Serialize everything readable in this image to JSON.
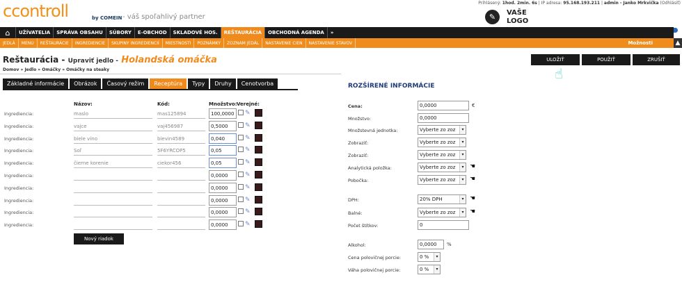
{
  "header": {
    "logo": "ccontroll",
    "by": "by COMEIN",
    "slogan": "- váš spoľahlivý partner",
    "login_label": "Prihlásený:",
    "login_time": "1hod. 2min. 6s",
    "ip_label": "IP adresa:",
    "ip": "95.168.193.211",
    "user": "admin - Janko Mrkvička",
    "logout": "(Odhlásiť)",
    "client_logo_line1": "VAŠE",
    "client_logo_line2": "LOGO"
  },
  "nav_main": [
    "UŽÍVATELIA",
    "SPRÁVA OBSAHU",
    "SÚBORY",
    "E-OBCHOD",
    "SKLADOVÉ HOS.",
    "REŠTAURÁCIA",
    "OBCHODNÁ AGENDA",
    "»"
  ],
  "nav_main_active": "REŠTAURÁCIA",
  "nav_sub": [
    "JEDLÁ",
    "MENU",
    "REŠTAURÁCIE",
    "INGREDIENCIE",
    "SKUPINY INGREDIENCIÍ",
    "MIESTNOSTI",
    "POZNÁMKY",
    "ZOZNAM JEDÁL",
    "NASTAVENIE CIEN",
    "NASTAVENIE STAVOV"
  ],
  "moznosti": "Možnosti",
  "page": {
    "title": "Reštaurácia -",
    "subtitle": "Upraviť jedlo -",
    "item_name": "Holandská omáčka",
    "breadcrumb": "Domov » Jedlo » Omáčky » Omáčky na steaky"
  },
  "actions": {
    "save": "ULOŽIŤ",
    "apply": "POUŽIŤ",
    "cancel": "ZRUŠIŤ"
  },
  "tabs": [
    "Základné informácie",
    "Obrázok",
    "Časový režim",
    "Receptúra",
    "Typy",
    "Druhy",
    "Cenotvorba"
  ],
  "active_tab": "Receptúra",
  "ingredients": {
    "col_name": "Názov:",
    "col_code": "Kód:",
    "col_qty": "Množstvo:",
    "col_public": "Verejné:",
    "row_label": "Ingrediencia:",
    "rows": [
      {
        "name": "maslo",
        "code": "mas125894",
        "qty": "100,0000"
      },
      {
        "name": "vajce",
        "code": "vaj456987",
        "qty": "0,5000"
      },
      {
        "name": "biele víno",
        "code": "bievin4589",
        "qty": "0,040"
      },
      {
        "name": "Soľ",
        "code": "5F6YRCOP5",
        "qty": "0,05"
      },
      {
        "name": "čierne korenie",
        "code": "ciekor456",
        "qty": "0,05"
      },
      {
        "name": "",
        "code": "",
        "qty": "0,0000"
      },
      {
        "name": "",
        "code": "",
        "qty": "0,0000"
      },
      {
        "name": "",
        "code": "",
        "qty": "0,0000"
      },
      {
        "name": "",
        "code": "",
        "qty": "0,0000"
      },
      {
        "name": "",
        "code": "",
        "qty": "0,0000"
      }
    ],
    "new_row_button": "Nový riadok"
  },
  "extended": {
    "heading": "ROZŠÍRENÉ INFORMÁCIE",
    "cena_label": "Cena:",
    "cena": "0,0000",
    "cena_unit": "€",
    "mnozstvo_label": "Množstvo:",
    "mnozstvo": "0,0000",
    "jednotka_label": "Množstevná jednotka:",
    "jednotka": "Vyberte zo zoz",
    "zobrazit1_label": "Zobraziť:",
    "zobrazit1": "Vyberte zo zoz",
    "zobrazit2_label": "Zobraziť:",
    "zobrazit2": "Vyberte zo zoz",
    "analyticka_label": "Analytická položka:",
    "analyticka": "Vyberte zo zoz",
    "pobocka_label": "Pobočka:",
    "pobocka": "Vyberte zo zoz",
    "dph_label": "DPH:",
    "dph": "20% DPH",
    "balne_label": "Balné:",
    "balne": "Vyberte zo zoz",
    "stitky_label": "Počet štítkov:",
    "stitky": "0",
    "alkohol_label": "Alkohol:",
    "alkohol": "0,0000",
    "alkohol_unit": "%",
    "cena_pol_label": "Cena polovičnej porcie:",
    "cena_pol": "0 %",
    "vaha_pol_label": "Váha polovičnej porcie:",
    "vaha_pol": "0 %"
  }
}
